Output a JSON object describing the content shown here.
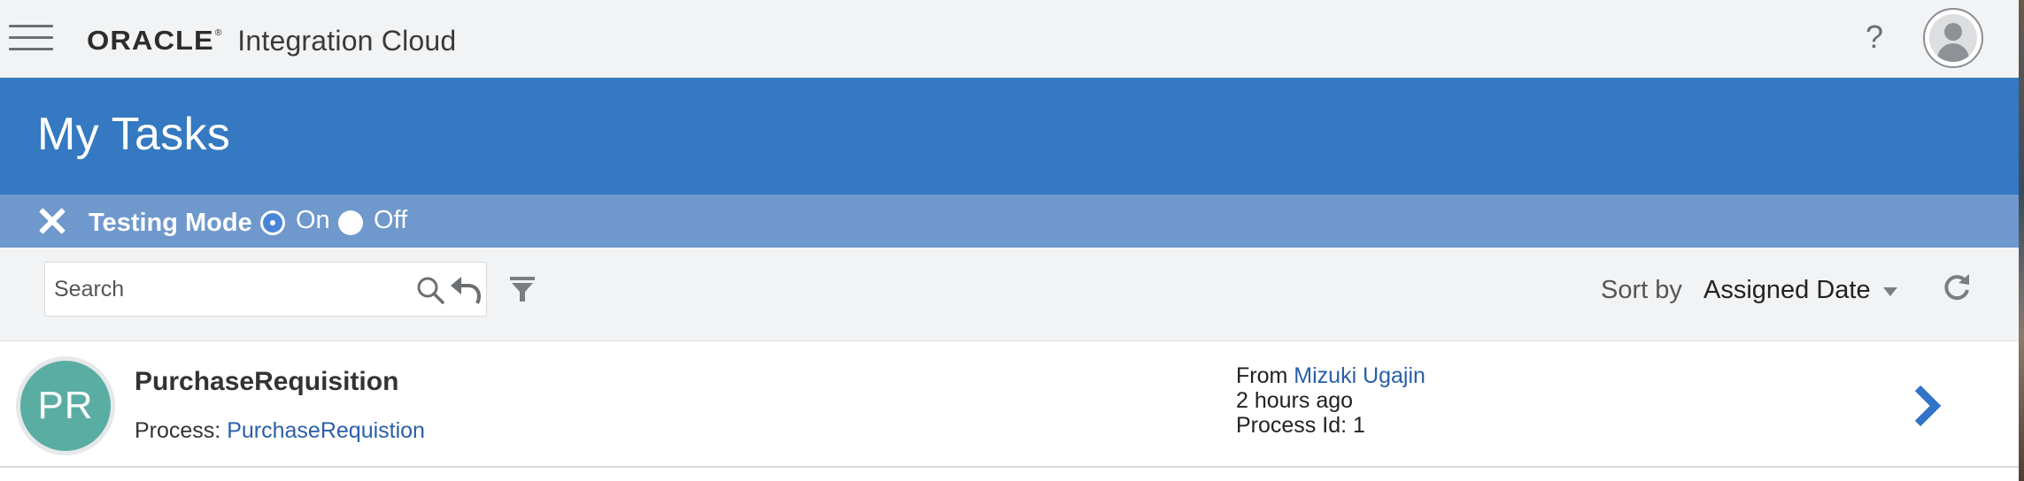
{
  "header": {
    "brand_logo": "ORACLE",
    "brand_trademark": "®",
    "product_name": "Integration Cloud",
    "help_label": "?"
  },
  "banner": {
    "title": "My Tasks"
  },
  "testing_mode": {
    "label": "Testing Mode",
    "options": [
      {
        "label": "On",
        "selected": true
      },
      {
        "label": "Off",
        "selected": false
      }
    ]
  },
  "toolbar": {
    "search_placeholder": "Search",
    "sort_label": "Sort by",
    "sort_value": "Assigned Date"
  },
  "tasks": [
    {
      "initials": "PR",
      "title": "PurchaseRequisition",
      "process_label": "Process:",
      "process_name": "PurchaseRequistion",
      "from_label": "From",
      "from_user": "Mizuki Ugajin",
      "time_ago": "2 hours ago",
      "process_id_label": "Process Id: 1"
    }
  ],
  "colors": {
    "banner": "#3479c1",
    "testing_strip": "#6f98cc",
    "task_avatar": "#5aada2",
    "link": "#2a5fa8",
    "chevron": "#2f74c8"
  }
}
